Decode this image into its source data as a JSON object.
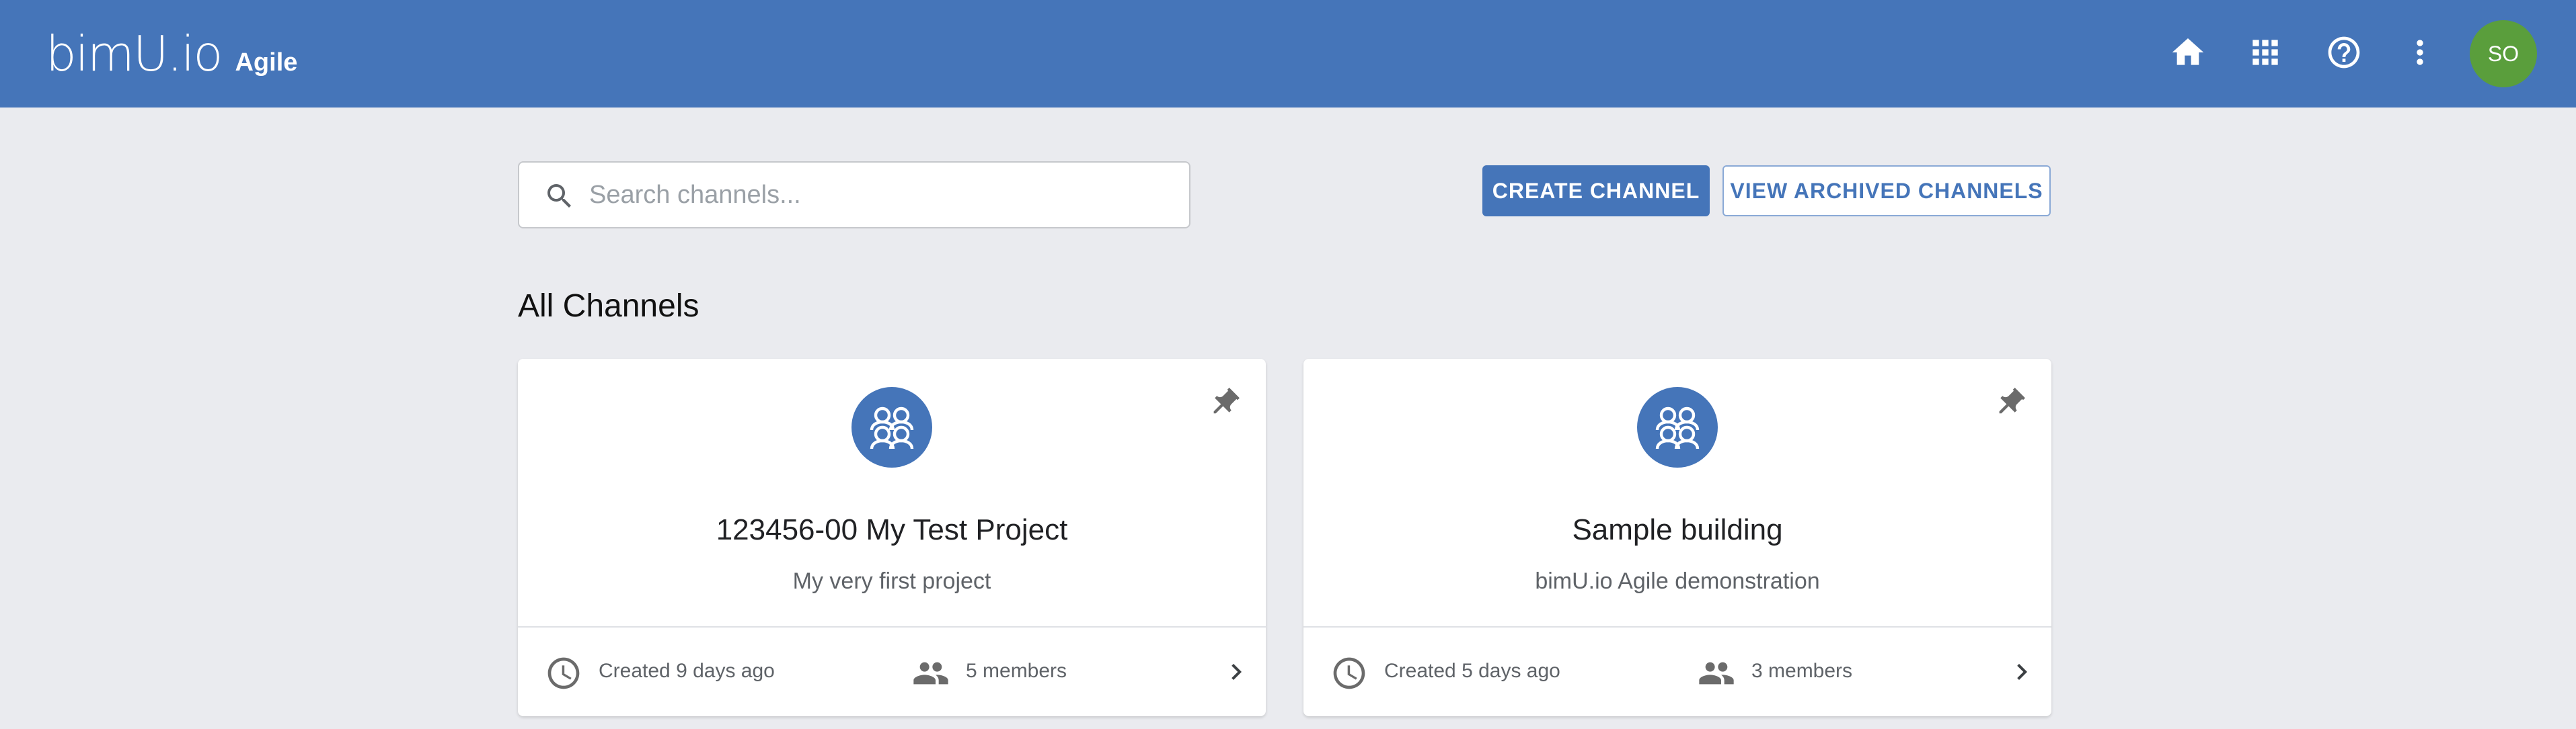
{
  "header": {
    "logo": "bimU.io",
    "app_name": "Agile",
    "avatar_initials": "SO",
    "icons": [
      "home-icon",
      "apps-grid-icon",
      "help-icon",
      "more-vert-icon"
    ]
  },
  "search": {
    "placeholder": "Search channels...",
    "value": ""
  },
  "actions": {
    "create_label": "CREATE CHANNEL",
    "archived_label": "VIEW ARCHIVED CHANNELS"
  },
  "section_title": "All Channels",
  "channels": [
    {
      "title": "123456-00 My Test Project",
      "description": "My very first project",
      "created": "Created 9 days ago",
      "members": "5 members"
    },
    {
      "title": "Sample building",
      "description": "bimU.io Agile demonstration",
      "created": "Created 5 days ago",
      "members": "3 members"
    }
  ],
  "colors": {
    "primary": "#4575b9",
    "background": "#eaebef",
    "avatar": "#5a9e3c"
  }
}
